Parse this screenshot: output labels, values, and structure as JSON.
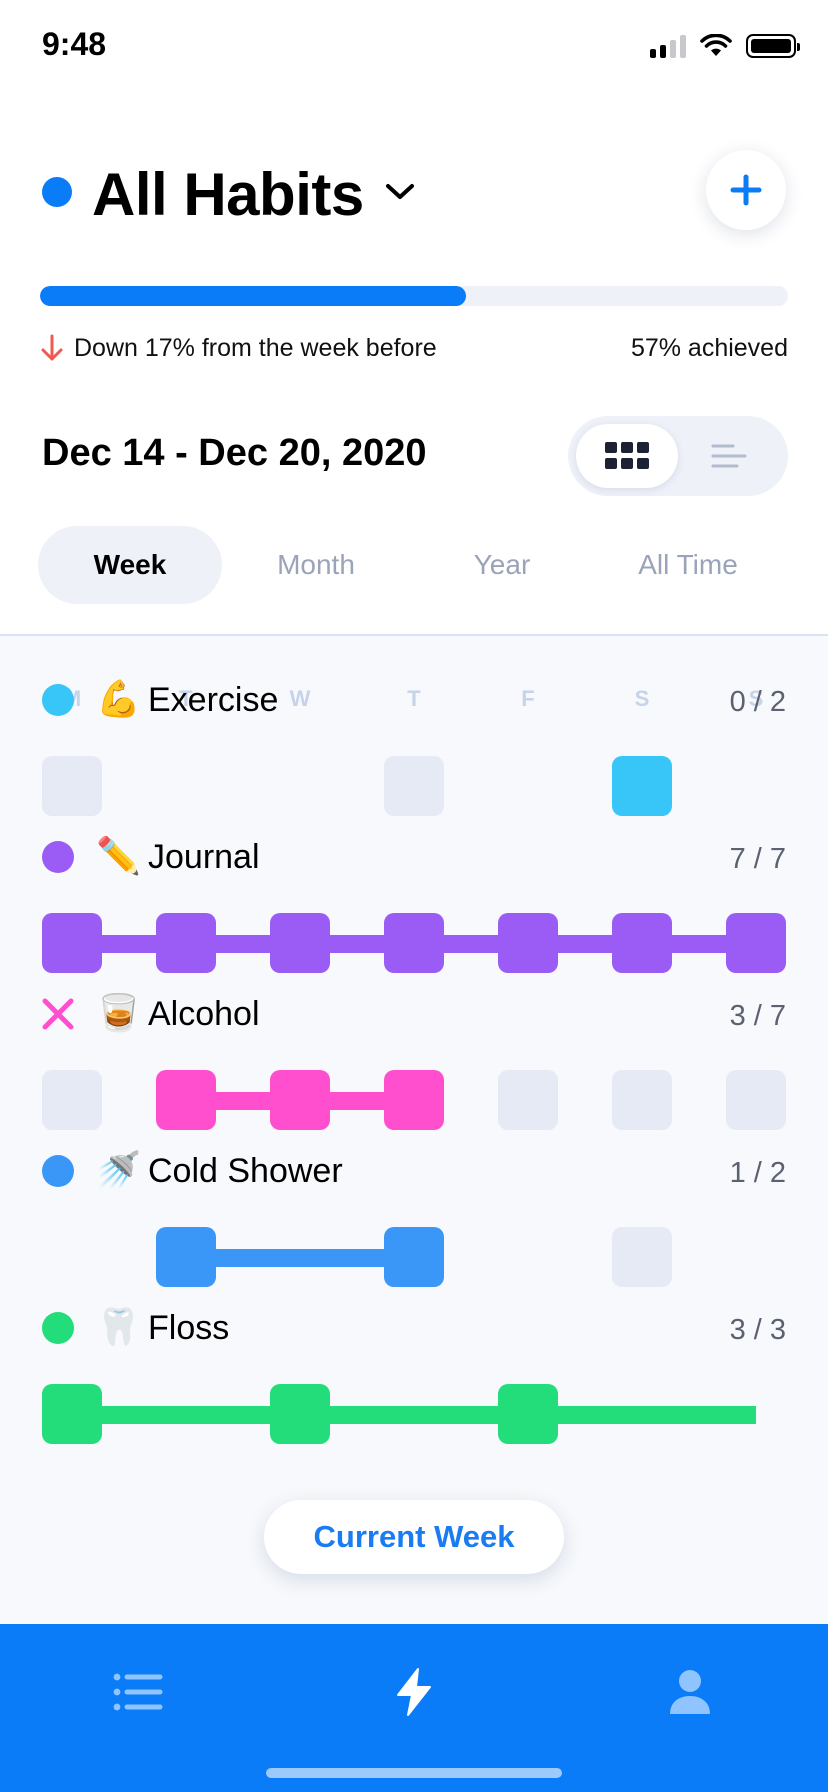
{
  "status_bar": {
    "time": "9:48"
  },
  "header": {
    "title": "All Habits",
    "dot_color": "#0a7cf8",
    "add_icon": "plus-icon",
    "dropdown_icon": "chevron-down-icon"
  },
  "progress": {
    "fraction": 0.57,
    "achieved_label": "57% achieved",
    "trend_text": "Down 17% from the week before",
    "trend_icon": "arrow-down-icon",
    "fill_color": "#0a7cf8",
    "trend_color": "#f25a4f"
  },
  "date_range": "Dec 14 - Dec 20, 2020",
  "view_toggle": {
    "options": [
      {
        "icon": "grid-icon",
        "active": true
      },
      {
        "icon": "list-bars-icon",
        "active": false
      }
    ]
  },
  "period_tabs": [
    {
      "label": "Week",
      "active": true
    },
    {
      "label": "Month",
      "active": false
    },
    {
      "label": "Year",
      "active": false
    },
    {
      "label": "All Time",
      "active": false
    }
  ],
  "weekdays": [
    "M",
    "T",
    "W",
    "T",
    "F",
    "S",
    "S"
  ],
  "habits": [
    {
      "emoji": "💪",
      "name": "Exercise",
      "count": "0 / 2",
      "status": "dot",
      "color": "#38c6f9",
      "days": [
        "empty",
        null,
        null,
        "empty",
        null,
        "done",
        null
      ]
    },
    {
      "emoji": "✏️",
      "name": "Journal",
      "count": "7 / 7",
      "status": "dot",
      "color": "#9b5cf6",
      "days": [
        "done",
        "done",
        "done",
        "done",
        "done",
        "done",
        "done"
      ]
    },
    {
      "emoji": "🥃",
      "name": "Alcohol",
      "count": "3 / 7",
      "status": "x",
      "color": "#ff4fcf",
      "days": [
        "empty",
        "done",
        "done",
        "done",
        "empty",
        "empty",
        "empty"
      ]
    },
    {
      "emoji": "🚿",
      "name": "Cold Shower",
      "count": "1 / 2",
      "status": "dot",
      "color": "#3a96f7",
      "days": [
        null,
        "done",
        null,
        "done",
        null,
        "empty",
        null
      ]
    },
    {
      "emoji": "🦷",
      "name": "Floss",
      "count": "3 / 3",
      "status": "dot",
      "color": "#22dd7a",
      "days": [
        "done",
        null,
        "done",
        null,
        "done",
        null,
        null
      ],
      "streak_continues": true
    }
  ],
  "current_week_button": "Current Week",
  "tab_bar": {
    "color": "#0a7cf8",
    "items": [
      {
        "icon": "list-icon",
        "active": false
      },
      {
        "icon": "lightning-icon",
        "active": true
      },
      {
        "icon": "profile-icon",
        "active": false
      }
    ]
  }
}
